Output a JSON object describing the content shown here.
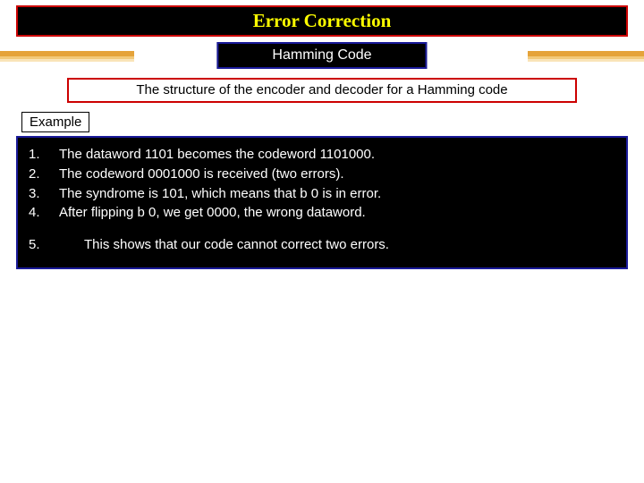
{
  "title": "Error Correction",
  "subtitle": "Hamming Code",
  "description": "The structure of the encoder and decoder for a Hamming code",
  "example_label": "Example",
  "steps": {
    "n1": "1.",
    "t1": "The dataword 1101 becomes the codeword 1101000.",
    "n2": "2.",
    "t2": "The codeword 0001000 is received (two errors).",
    "n3": "3.",
    "t3": "The syndrome is 101, which means that b 0 is in error.",
    "n4": "4.",
    "t4": "After flipping b 0, we get 0000, the wrong dataword.",
    "n5": "5.",
    "t5": "This shows that our code cannot correct two errors."
  }
}
